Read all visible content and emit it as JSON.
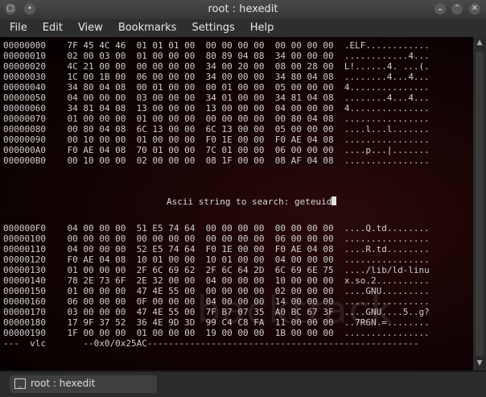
{
  "window": {
    "title": "root : hexedit"
  },
  "menu": [
    "File",
    "Edit",
    "View",
    "Bookmarks",
    "Settings",
    "Help"
  ],
  "hex_top": [
    "00000000    7F 45 4C 46  01 01 01 00  00 00 00 00  00 00 00 00  .ELF............",
    "00000010    02 00 03 00  01 00 00 00  80 89 04 08  34 00 00 00  ............4...",
    "00000020    4C 21 00 00  00 00 00 00  34 00 20 00  08 00 28 00  L!......4. ...(.",
    "00000030    1C 00 1B 00  06 00 00 00  34 00 00 00  34 80 04 08  ........4...4...",
    "00000040    34 80 04 08  00 01 00 00  00 01 00 00  05 00 00 00  4...............",
    "00000050    04 00 00 00  03 00 00 00  34 01 00 00  34 81 04 08  ........4...4...",
    "00000060    34 81 04 08  13 00 00 00  13 00 00 00  04 00 00 00  4...............",
    "00000070    01 00 00 00  01 00 00 00  00 00 00 00  00 80 04 08  ................",
    "00000080    00 80 04 08  6C 13 00 00  6C 13 00 00  05 00 00 00  ....l...l.......",
    "00000090    00 10 00 00  01 00 00 00  F0 1E 00 00  F0 AE 04 08  ................",
    "000000A0    F0 AE 04 08  70 01 00 00  7C 01 00 00  06 00 00 00  ....p...|.......",
    "000000B0    00 10 00 00  02 00 00 00  08 1F 00 00  08 AF 04 08  ................"
  ],
  "search": {
    "prompt": "Ascii string to search: ",
    "value": "geteuid"
  },
  "hex_bottom": [
    "000000F0    04 00 00 00  51 E5 74 64  00 00 00 00  00 00 00 00  ....Q.td........",
    "00000100    00 00 00 00  00 00 00 00  00 00 00 00  06 00 00 00  ................",
    "00000110    04 00 00 00  52 E5 74 64  F0 1E 00 00  F0 AE 04 08  ....R.td........",
    "00000120    F0 AE 04 08  10 01 00 00  10 01 00 00  04 00 00 00  ................",
    "00000130    01 00 00 00  2F 6C 69 62  2F 6C 64 2D  6C 69 6E 75  ..../lib/ld-linu",
    "00000140    78 2E 73 6F  2E 32 00 00  04 00 00 00  10 00 00 00  x.so.2..........",
    "00000150    01 00 00 00  47 4E 55 00  00 00 00 00  02 00 00 00  ....GNU.........",
    "00000160    06 00 00 00  0F 00 00 00  04 00 00 00  14 00 00 00  ................",
    "00000170    03 00 00 00  47 4E 55 00  7F B7 07 35  A0 BC 67 3F  ....GNU....5..g?",
    "00000180    17 9F 37 52  36 4E 9D 3D  99 C4 C8 FA  11 00 00 00  ..7R6N.=........",
    "00000190    1F 00 00 00  01 00 00 00  19 00 00 00  1B 00 00 00  ................"
  ],
  "status_line": "---  vlc       --0x0/0x25AC---------------------------------------------------",
  "watermark": "backtrack",
  "taskbar": {
    "task_label": "root : hexedit"
  }
}
